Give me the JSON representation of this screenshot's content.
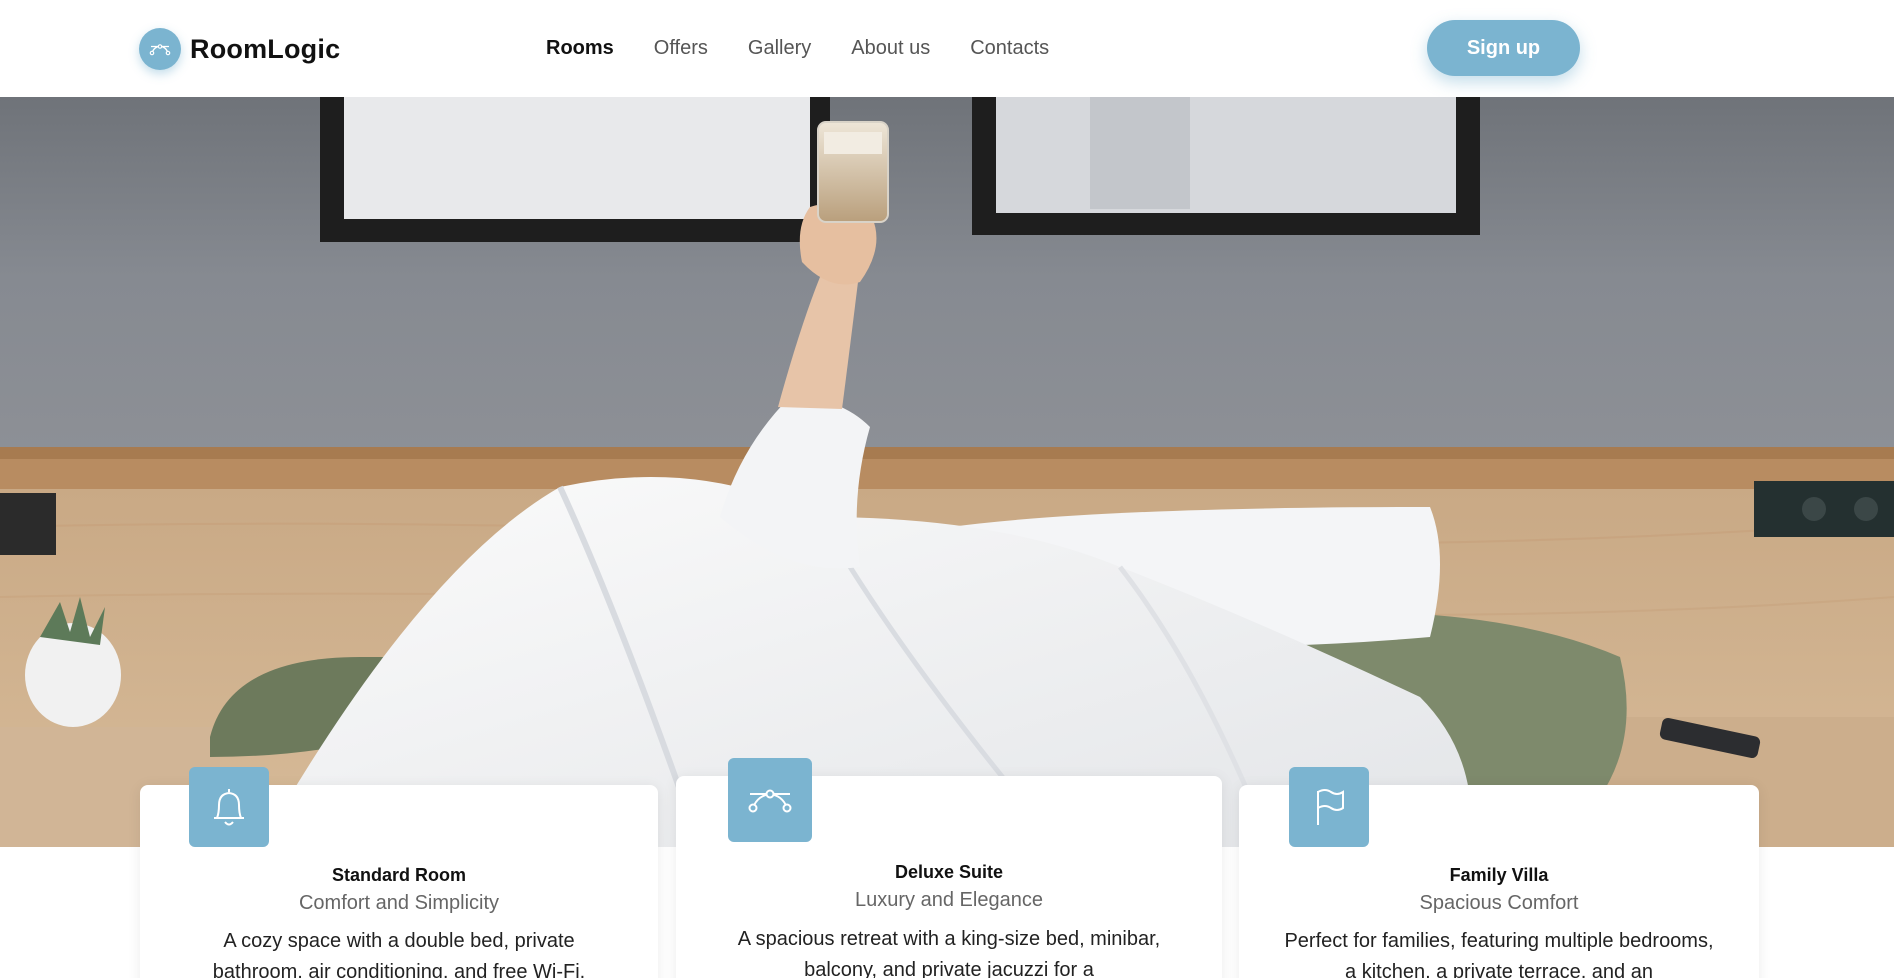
{
  "brand": {
    "name": "RoomLogic",
    "icon": "bezier-curve-icon",
    "accent": "#7bb4d0"
  },
  "nav": {
    "items": [
      {
        "label": "Rooms",
        "active": true
      },
      {
        "label": "Offers",
        "active": false
      },
      {
        "label": "Gallery",
        "active": false
      },
      {
        "label": "About us",
        "active": false
      },
      {
        "label": "Contacts",
        "active": false
      }
    ]
  },
  "header": {
    "signup_label": "Sign up"
  },
  "hero": {
    "image": "hotel-bed-photo"
  },
  "cards": [
    {
      "icon": "bell-icon",
      "title": "Standard Room",
      "subtitle": "Comfort and Simplicity",
      "description": "A cozy space with a double bed, private bathroom, air conditioning, and free Wi-Fi."
    },
    {
      "icon": "bezier-curve-icon",
      "title": "Deluxe Suite",
      "subtitle": "Luxury and Elegance",
      "description": "A spacious retreat with a king-size bed, minibar, balcony, and private jacuzzi for a"
    },
    {
      "icon": "flag-icon",
      "title": "Family Villa",
      "subtitle": "Spacious Comfort",
      "description": "Perfect for families, featuring multiple bedrooms, a kitchen, a private terrace, and an"
    }
  ]
}
